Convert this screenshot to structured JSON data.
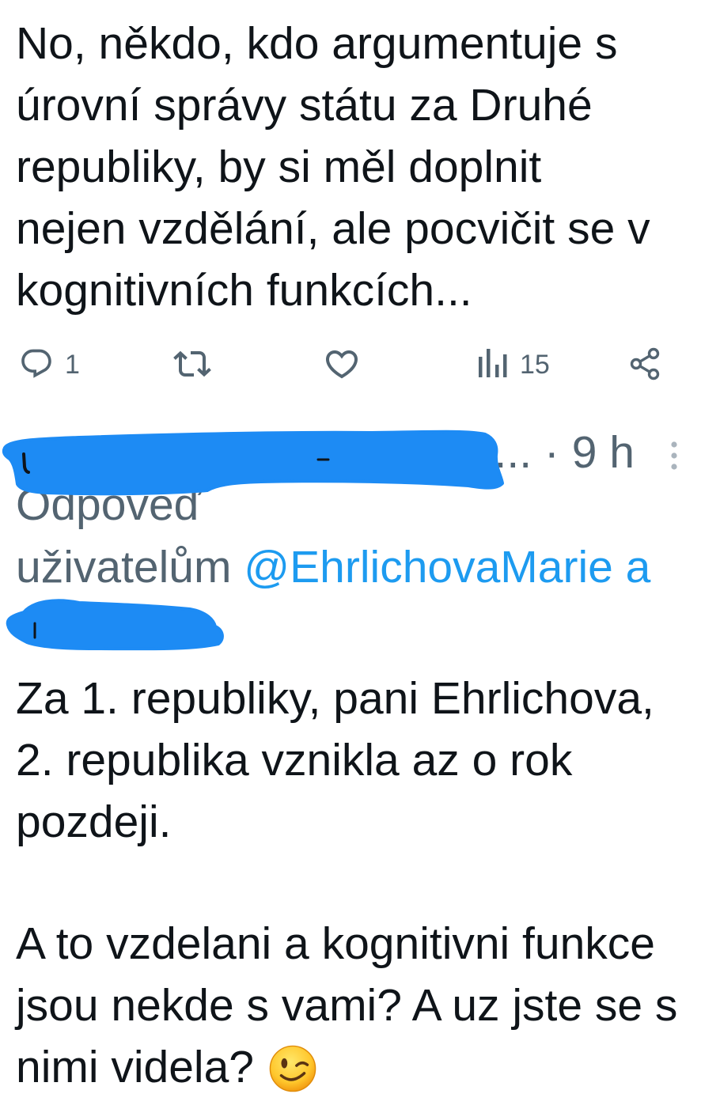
{
  "tweet": {
    "text_lines": [
      "No, někdo, kdo argumentuje s",
      "úrovní správy státu za Druhé",
      "republiky, by si měl doplnit",
      "nejen vzdělání, ale pocvičit se v",
      "kognitivních funkcích..."
    ],
    "actions": {
      "reply_icon": "reply-icon",
      "reply_count": "1",
      "retweet_icon": "retweet-icon",
      "like_icon": "heart-icon",
      "views_icon": "views-icon",
      "views_count": "15",
      "share_icon": "share-icon"
    }
  },
  "reply": {
    "header": {
      "handle_truncated": "a...",
      "separator": "·",
      "time": "9 h"
    },
    "menu_icon": "more-vertical-icon",
    "replying_to": {
      "label": "Odpověď",
      "prefix": "uživatelům",
      "handle": "@EhrlichovaMarie",
      "conjunction": "a"
    },
    "paragraph_1": [
      "Za 1. republiky, pani Ehrlichova,",
      "2. republika vznikla az o rok",
      "pozdeji."
    ],
    "paragraph_2": [
      "A to vzdelani a kognitivni funkce",
      "jsou nekde s vami? A uz jste se s",
      "nimi videla?"
    ],
    "emoji_icon": "winking-face-emoji"
  },
  "colors": {
    "text": "#0f1419",
    "secondary": "#536471",
    "link": "#1d9bf0",
    "redaction": "#1d8bf4",
    "menu_dots": "#aab4bd"
  }
}
